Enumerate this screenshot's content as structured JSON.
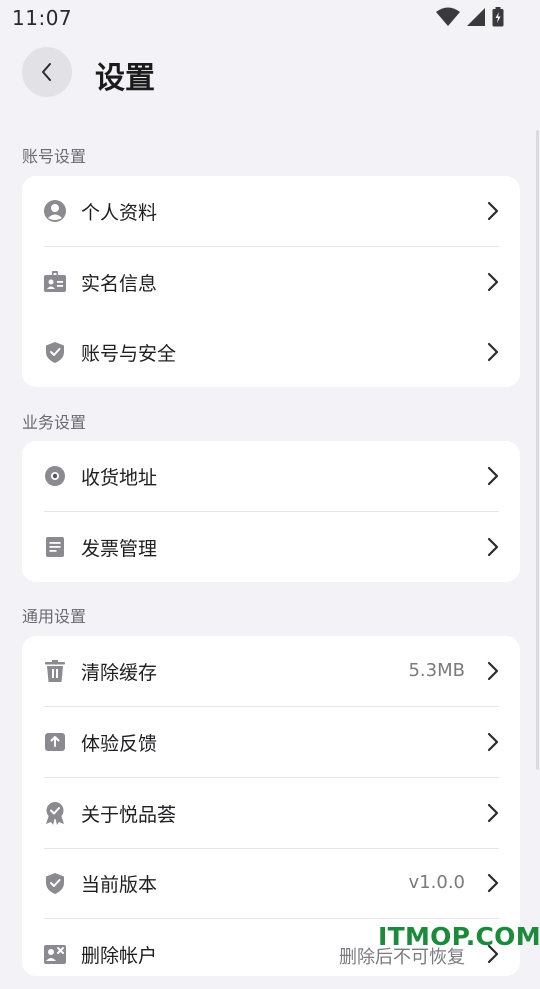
{
  "status_bar": {
    "time": "11:07"
  },
  "header": {
    "title": "设置"
  },
  "sections": [
    {
      "label": "账号设置",
      "items": [
        {
          "icon": "person-icon",
          "label": "个人资料"
        },
        {
          "icon": "id-card-icon",
          "label": "实名信息"
        },
        {
          "icon": "shield-icon",
          "label": "账号与安全"
        }
      ]
    },
    {
      "label": "业务设置",
      "items": [
        {
          "icon": "location-pin-icon",
          "label": "收货地址"
        },
        {
          "icon": "invoice-icon",
          "label": "发票管理"
        }
      ]
    },
    {
      "label": "通用设置",
      "items": [
        {
          "icon": "trash-icon",
          "label": "清除缓存",
          "value": "5.3MB"
        },
        {
          "icon": "feedback-icon",
          "label": "体验反馈"
        },
        {
          "icon": "badge-icon",
          "label": "关于悦品荟"
        },
        {
          "icon": "shield-check-icon",
          "label": "当前版本",
          "value": "v1.0.0"
        },
        {
          "icon": "delete-account-icon",
          "label": "删除帐户",
          "value": "删除后不可恢复"
        }
      ]
    }
  ],
  "watermark": "ITMOP.COM",
  "colors": {
    "background": "#f3f3f7",
    "card": "#ffffff",
    "icon": "#8a8a90",
    "watermark": "#1b8a3a"
  }
}
